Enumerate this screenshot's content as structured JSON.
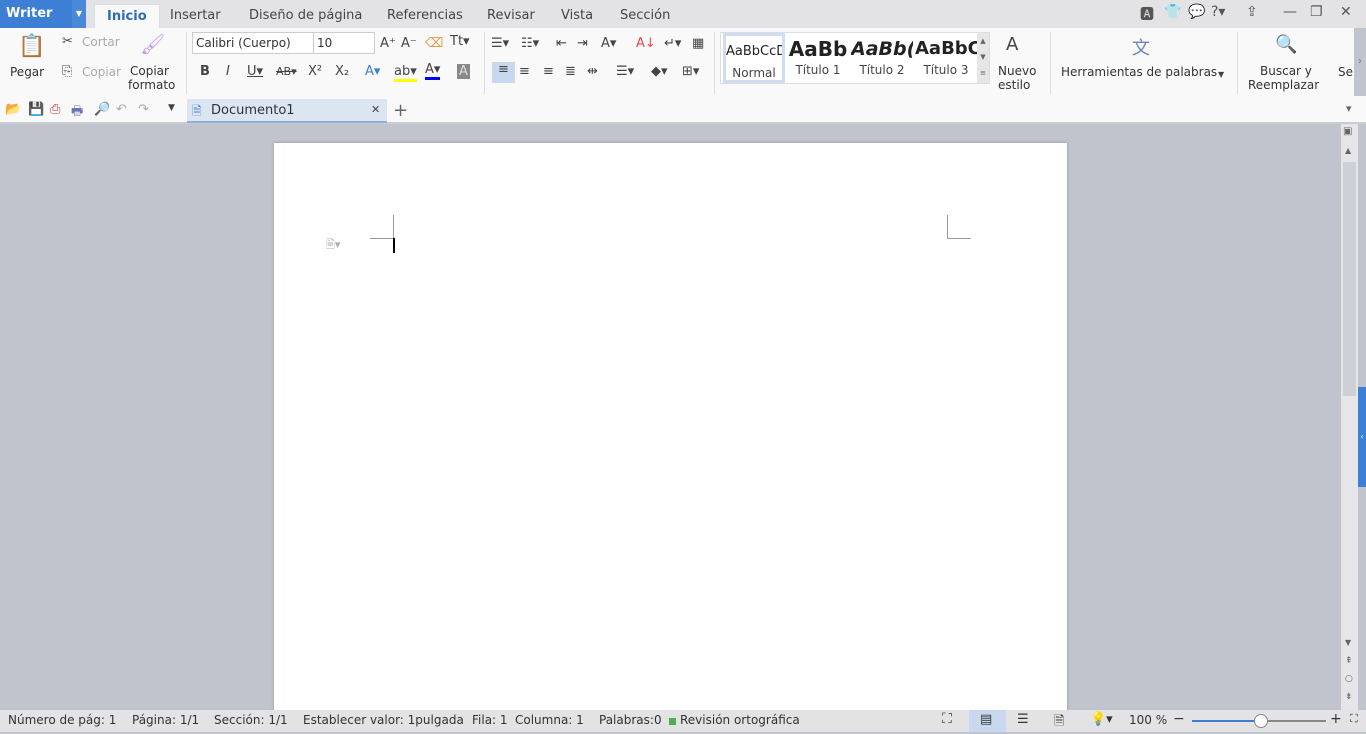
{
  "app": {
    "name": "Writer",
    "accent": "#3d7fd5"
  },
  "menu_tabs": [
    "Inicio",
    "Insertar",
    "Diseño de página",
    "Referencias",
    "Revisar",
    "Vista",
    "Sección"
  ],
  "ribbon": {
    "paste": "Pegar",
    "cut": "Cortar",
    "copy": "Copiar",
    "format_painter": [
      "Copiar",
      "formato"
    ],
    "font_name": "Calibri (Cuerpo)",
    "font_size": "10",
    "styles": [
      {
        "preview": "AaBbCcD",
        "name": "Normal"
      },
      {
        "preview": "AaBb",
        "name": "Título 1"
      },
      {
        "preview": "AaBb(",
        "name": "Título 2"
      },
      {
        "preview": "AaBbC",
        "name": "Título 3"
      }
    ],
    "new_style": [
      "Nuevo",
      "estilo"
    ],
    "word_tools": "Herramientas de palabras",
    "find_replace": [
      "Buscar y",
      "Reemplazar"
    ],
    "more": "Se"
  },
  "document_tab": "Documento1",
  "status": {
    "page_num": "Número de pág: 1",
    "page": "Página: 1/1",
    "section": "Sección: 1/1",
    "set_value": "Establecer valor: 1pulgada",
    "row": "Fila: 1",
    "column": "Columna: 1",
    "words": "Palabras:0",
    "spell": "Revisión ortográfica",
    "zoom": "100 %",
    "zoom_level": 100
  }
}
